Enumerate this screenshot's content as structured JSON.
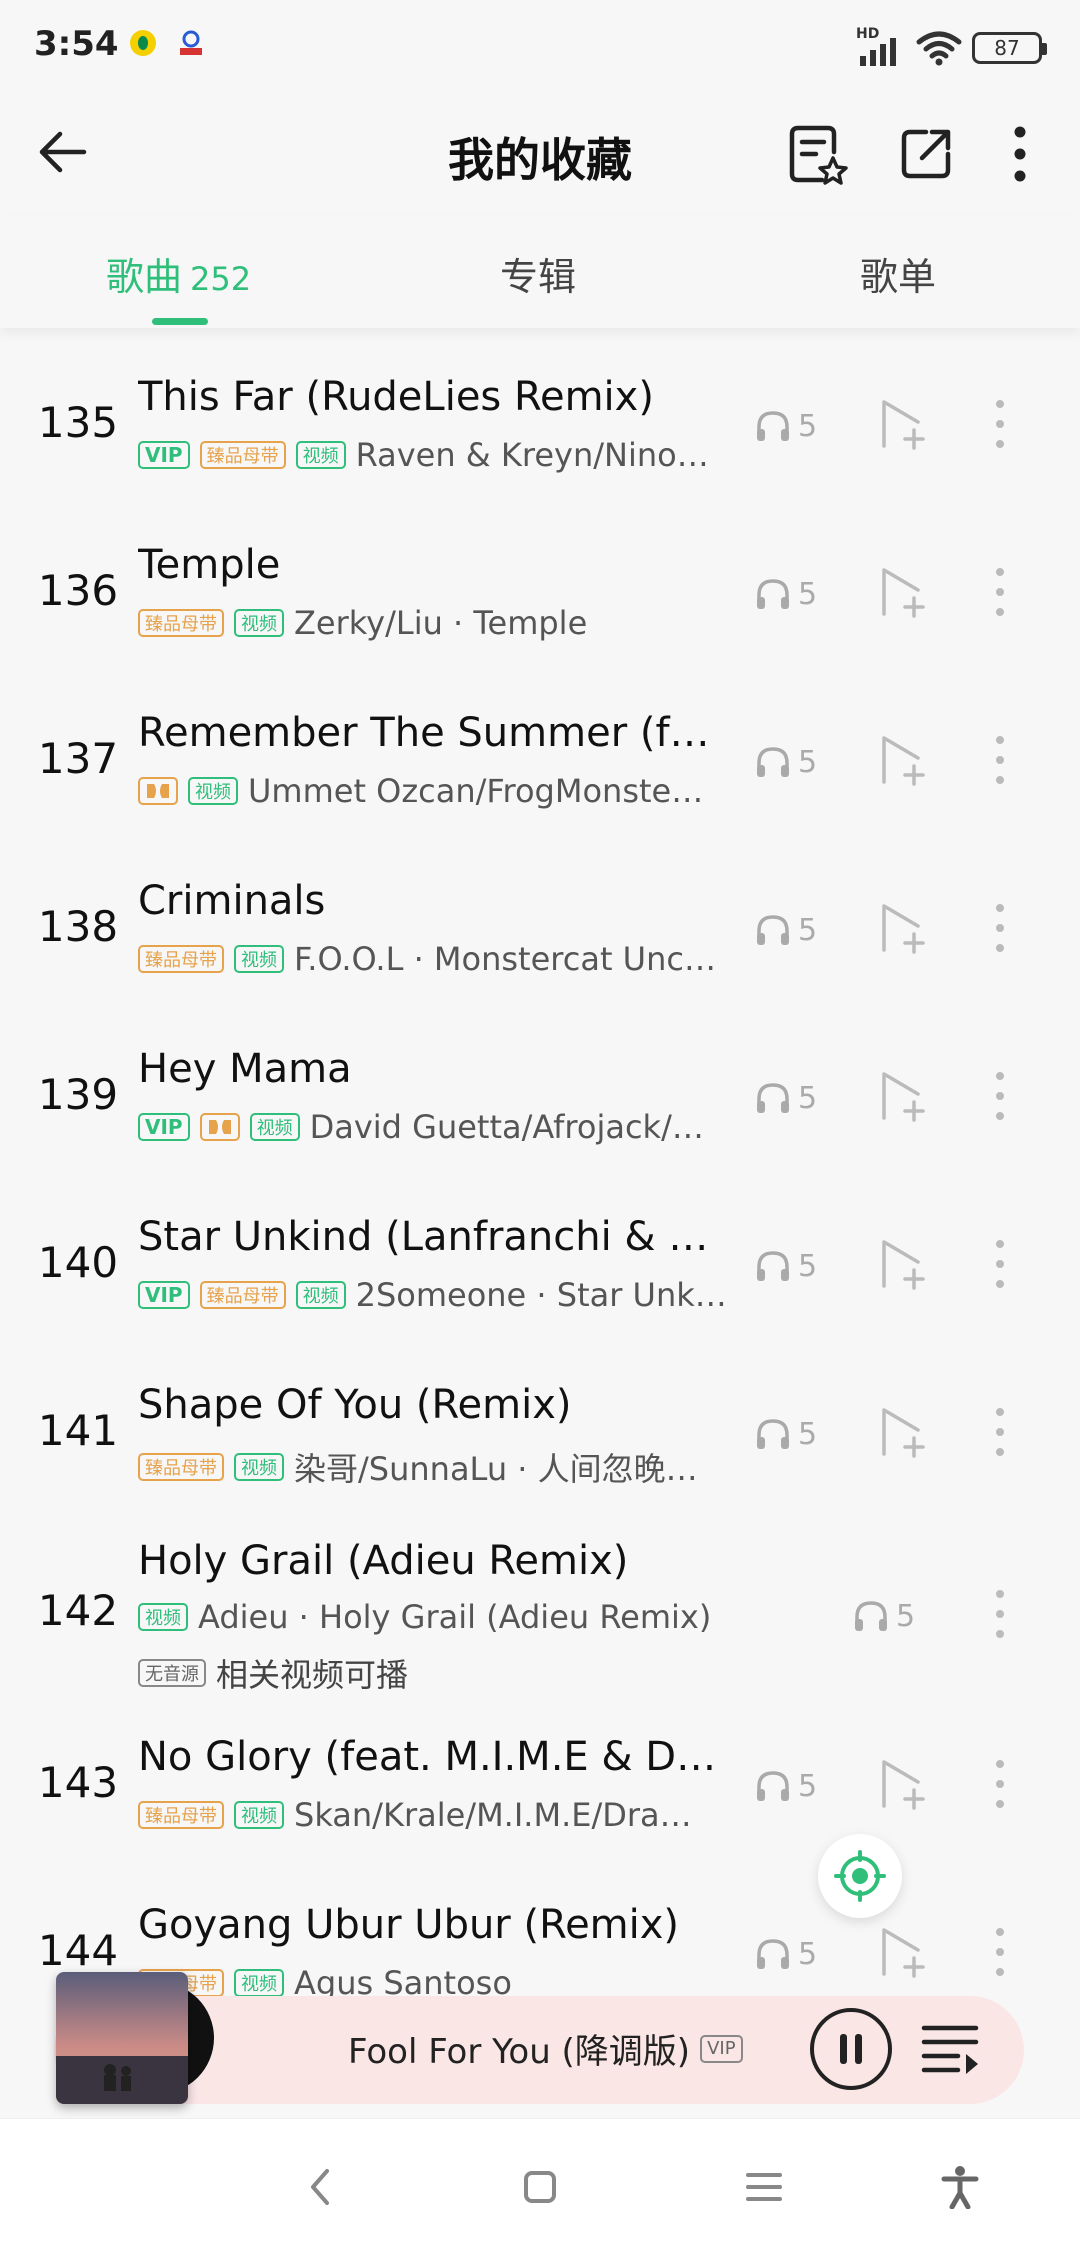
{
  "status_bar": {
    "time": "3:54",
    "network": "HD",
    "battery": "87"
  },
  "header": {
    "title": "我的收藏"
  },
  "tabs": [
    {
      "label": "歌曲",
      "count": "252",
      "active": true
    },
    {
      "label": "专辑",
      "active": false
    },
    {
      "label": "歌单",
      "active": false
    }
  ],
  "songs": [
    {
      "num": "135",
      "title": "This Far (RudeLies Remix)",
      "tags": [
        "VIP",
        "臻品母带",
        "视频"
      ],
      "meta": "Raven & Kreyn/Nino…",
      "listens": "5"
    },
    {
      "num": "136",
      "title": "Temple",
      "tags": [
        "臻品母带",
        "视频"
      ],
      "meta": "Zerky/Liu · Temple",
      "listens": "5"
    },
    {
      "num": "137",
      "title": "Remember The Summer (f…",
      "tags": [
        "dolby",
        "视频"
      ],
      "meta": "Ummet Ozcan/FrogMonste…",
      "listens": "5"
    },
    {
      "num": "138",
      "title": "Criminals",
      "tags": [
        "臻品母带",
        "视频"
      ],
      "meta": "F.O.O.L · Monstercat Unc…",
      "listens": "5"
    },
    {
      "num": "139",
      "title": "Hey Mama",
      "tags": [
        "VIP",
        "dolby",
        "视频"
      ],
      "meta": "David Guetta/Afrojack/…",
      "listens": "5"
    },
    {
      "num": "140",
      "title": "Star Unkind (Lanfranchi & F…",
      "tags": [
        "VIP",
        "臻品母带",
        "视频"
      ],
      "meta": "2Someone · Star Unk…",
      "listens": "5"
    },
    {
      "num": "141",
      "title": "Shape Of You (Remix)",
      "tags": [
        "臻品母带",
        "视频"
      ],
      "meta": "染哥/SunnaLu · 人间忽晚…",
      "listens": "5"
    },
    {
      "num": "142",
      "title": "Holy Grail (Adieu Remix)",
      "tags": [
        "视频"
      ],
      "meta": "Adieu · Holy Grail (Adieu Remix)",
      "listens": "5",
      "sub_tag": "无音源",
      "sub_text": "相关视频可播"
    },
    {
      "num": "143",
      "title": "No Glory (feat. M.I.M.E & Dr…",
      "tags": [
        "臻品母带",
        "视频"
      ],
      "meta": "Skan/Krale/M.I.M.E/Dra…",
      "listens": "5"
    },
    {
      "num": "144",
      "title": "Goyang Ubur Ubur (Remix)",
      "tags": [
        "臻品母带",
        "视频"
      ],
      "meta": "Agus Santoso",
      "listens": "5"
    }
  ],
  "player": {
    "title": "Fool For You (降调版)",
    "badge": "VIP"
  },
  "colors": {
    "accent": "#2fbf7a",
    "gold": "#e7a24c",
    "player_bg": "#fbe6e6"
  }
}
